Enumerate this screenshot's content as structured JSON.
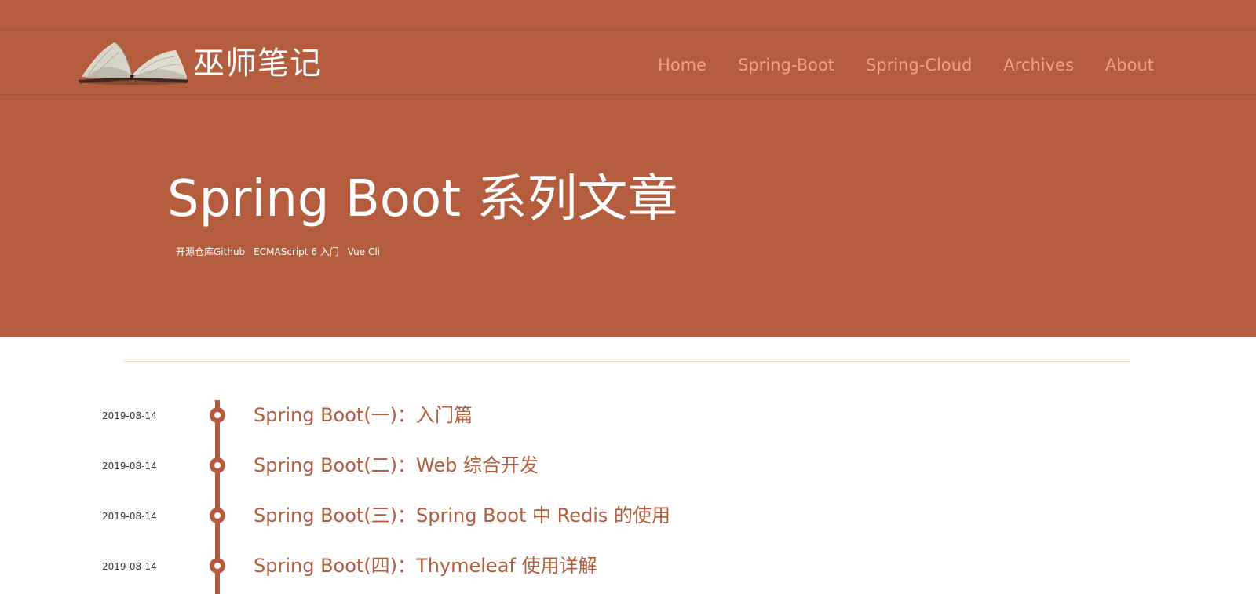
{
  "header": {
    "site_title": "巫师笔记",
    "logo_icon": "open-book-icon"
  },
  "nav": {
    "items": [
      {
        "label": "Home"
      },
      {
        "label": "Spring-Boot"
      },
      {
        "label": "Spring-Cloud"
      },
      {
        "label": "Archives"
      },
      {
        "label": "About"
      }
    ]
  },
  "hero": {
    "title": "Spring Boot 系列文章",
    "links": [
      {
        "label": "开源仓库Github"
      },
      {
        "label": "ECMAScript 6 入门"
      },
      {
        "label": "Vue Cli"
      }
    ]
  },
  "posts": [
    {
      "date": "2019-08-14",
      "title": "Spring Boot(一)：入门篇"
    },
    {
      "date": "2019-08-14",
      "title": "Spring Boot(二)：Web 综合开发"
    },
    {
      "date": "2019-08-14",
      "title": "Spring Boot(三)：Spring Boot 中 Redis 的使用"
    },
    {
      "date": "2019-08-14",
      "title": "Spring Boot(四)：Thymeleaf 使用详解"
    }
  ],
  "colors": {
    "accent": "#b35c3e",
    "nav_link": "#f0a285",
    "divider": "#f2d9cc"
  }
}
